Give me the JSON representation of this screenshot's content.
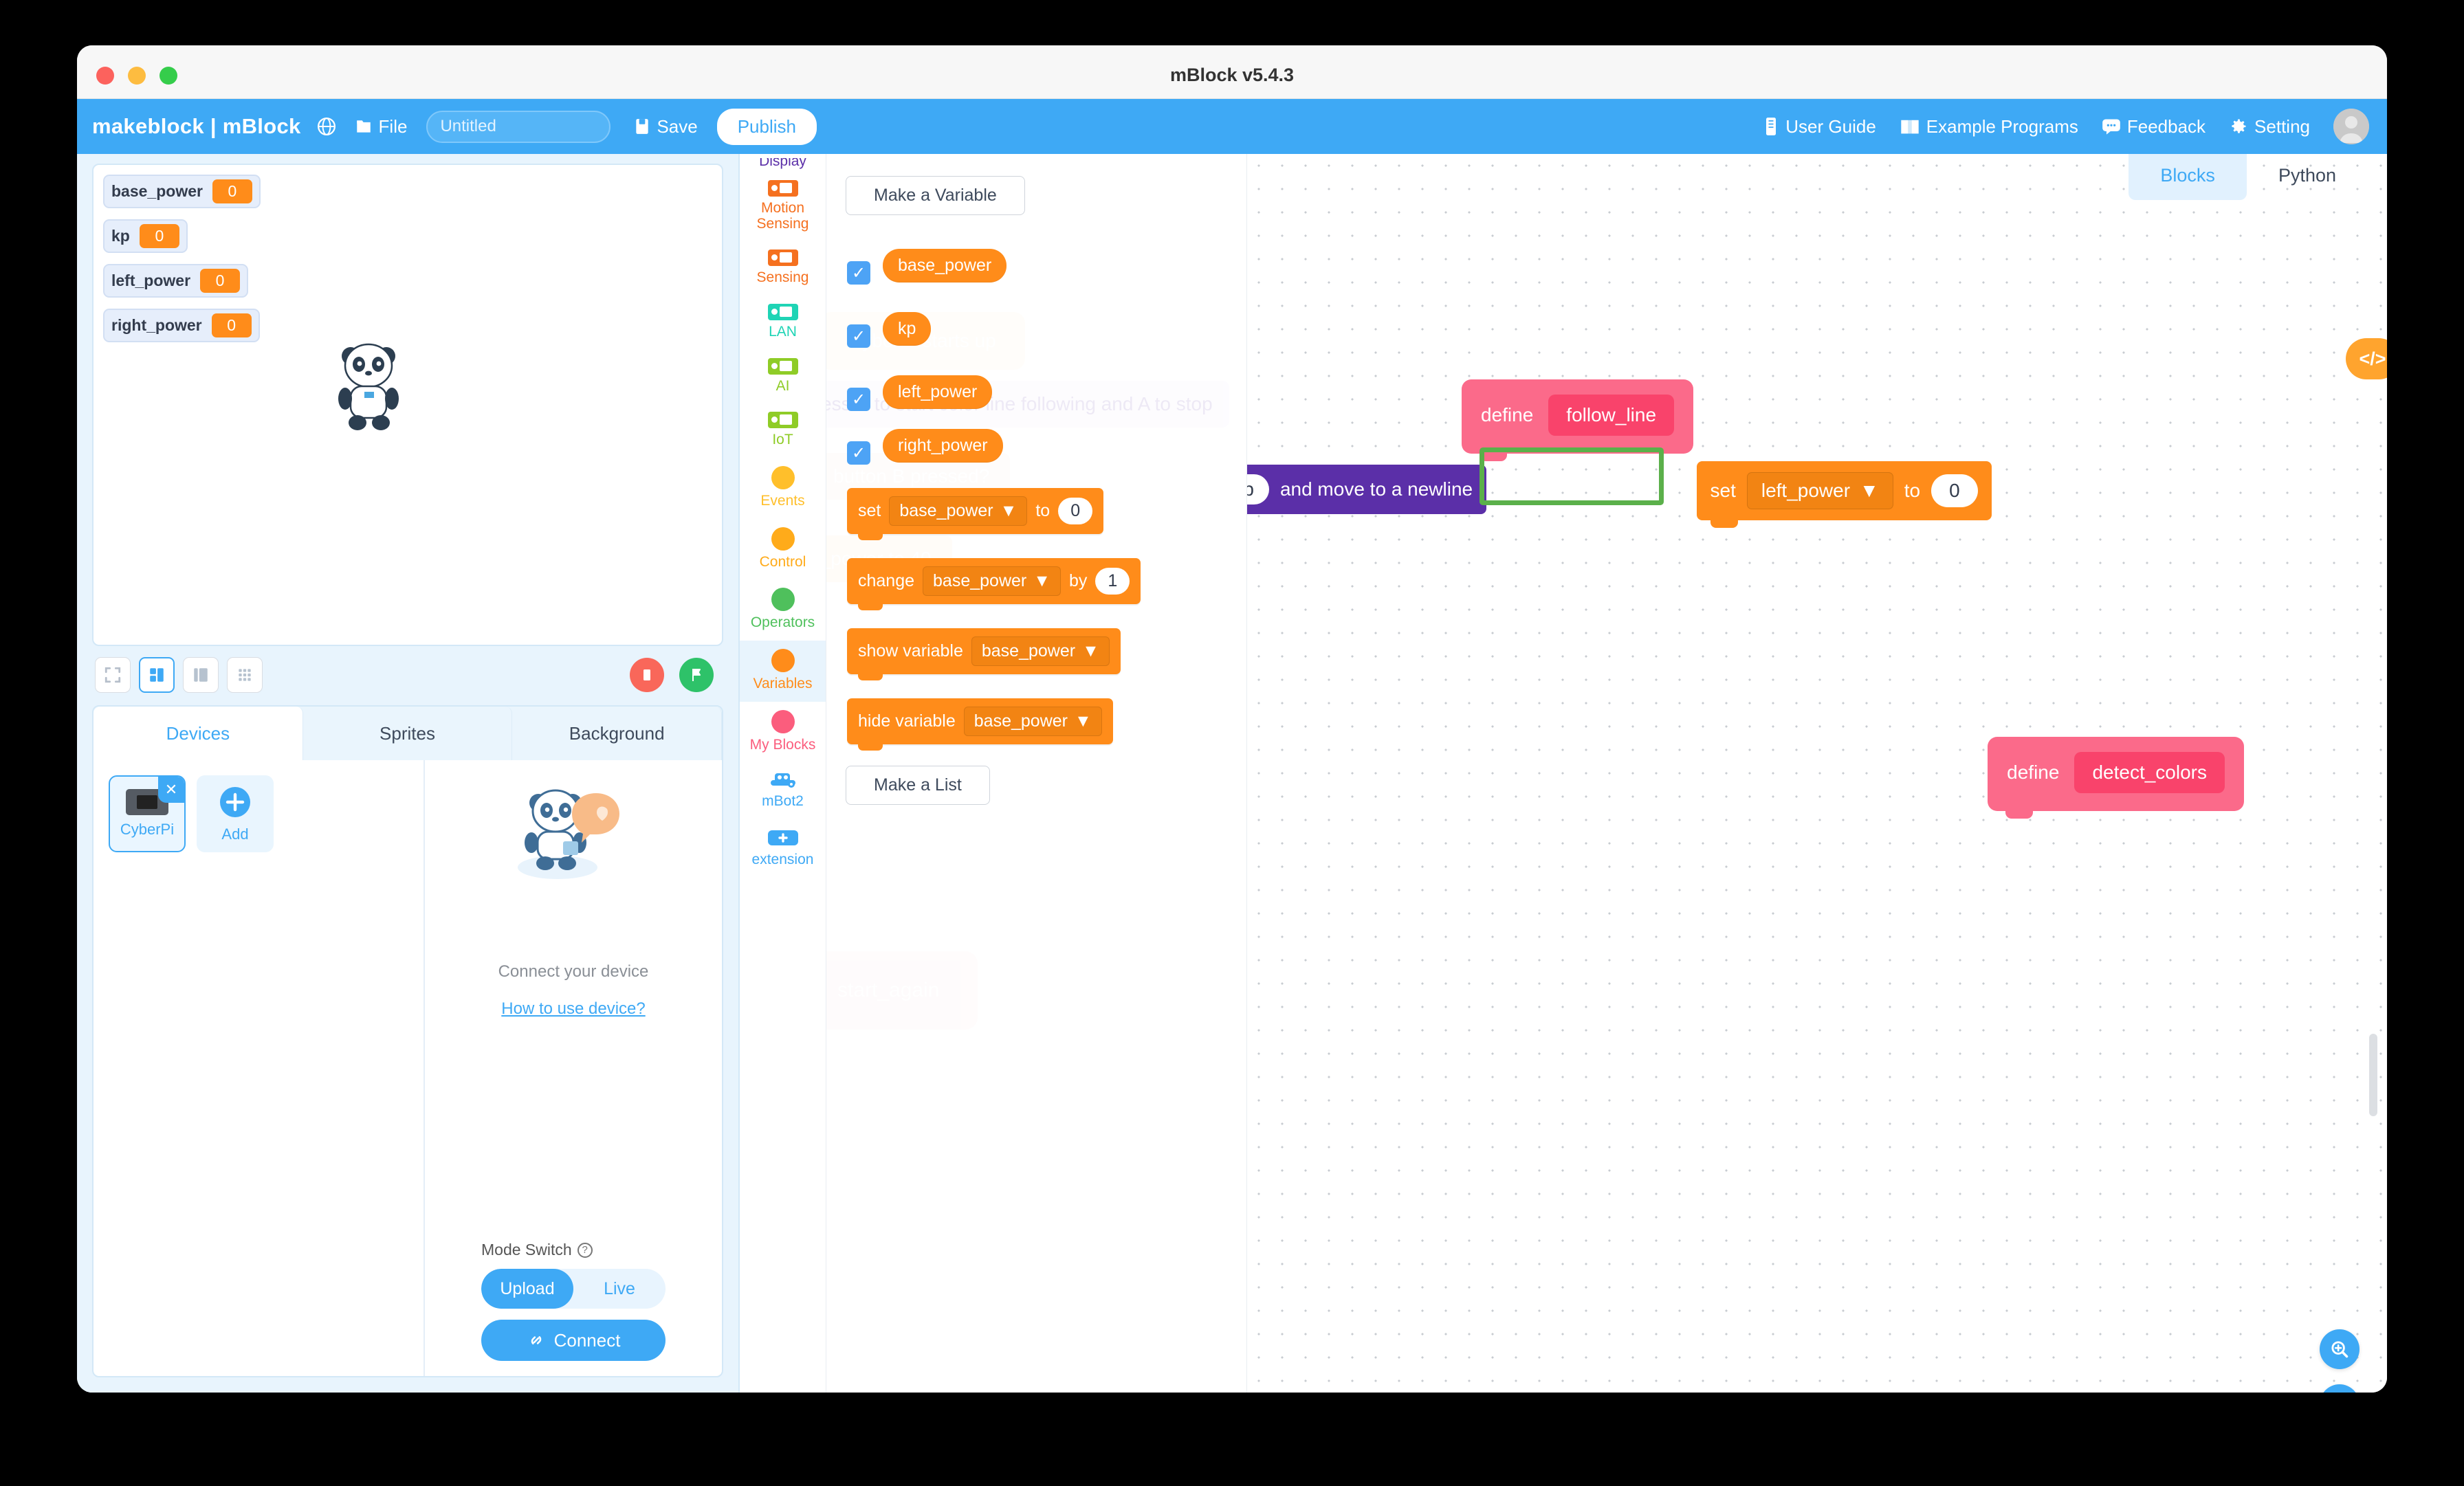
{
  "window": {
    "title": "mBlock v5.4.3"
  },
  "toolbar": {
    "brand": "makeblock | mBlock",
    "globe_icon": "globe-icon",
    "file_icon": "folder-icon",
    "file_label": "File",
    "project_name_value": "Untitled",
    "project_name_placeholder": "Untitled",
    "save_icon": "save-icon",
    "save_label": "Save",
    "publish_label": "Publish",
    "right_items": [
      {
        "label": "User Guide",
        "icon": "book-icon"
      },
      {
        "label": "Example Programs",
        "icon": "open-book-icon"
      },
      {
        "label": "Feedback",
        "icon": "chat-icon"
      },
      {
        "label": "Setting",
        "icon": "gear-icon"
      }
    ],
    "avatar_icon": "avatar-icon"
  },
  "stage": {
    "monitors": [
      {
        "name": "base_power",
        "value": "0"
      },
      {
        "name": "kp",
        "value": "0"
      },
      {
        "name": "left_power",
        "value": "0"
      },
      {
        "name": "right_power",
        "value": "0"
      }
    ],
    "sprite_icon": "panda-sprite",
    "controls": [
      {
        "name": "fullscreen-button",
        "icon": "fullscreen-icon"
      },
      {
        "name": "small-stage-button",
        "icon": "split-layout-icon"
      },
      {
        "name": "large-stage-button",
        "icon": "wide-layout-icon"
      },
      {
        "name": "grid-stage-button",
        "icon": "grid-icon"
      }
    ],
    "stop_icon": "stop-icon",
    "go_icon": "green-flag-icon"
  },
  "device_panel": {
    "tabs": [
      {
        "label": "Devices",
        "active": true
      },
      {
        "label": "Sprites",
        "active": false
      },
      {
        "label": "Background",
        "active": false
      }
    ],
    "devices": [
      {
        "label": "CyberPi",
        "selected": true,
        "close_icon": "close-icon"
      },
      {
        "label": "Add",
        "selected": false,
        "icon": "plus-icon"
      }
    ],
    "connect_text": "Connect your device",
    "howto_link": "How to use device?",
    "mode_label": "Mode Switch",
    "mode_help_icon": "question-icon",
    "mode_options": [
      {
        "label": "Upload",
        "active": true
      },
      {
        "label": "Live",
        "active": false
      }
    ],
    "connect_button": "Connect",
    "connect_icon": "link-icon"
  },
  "categories": [
    {
      "label": "Display",
      "color": "#5b2fa8",
      "shape": "board",
      "selected": false,
      "partial": true
    },
    {
      "label": "Motion Sensing",
      "color": "#f5701f",
      "shape": "board",
      "selected": false
    },
    {
      "label": "Sensing",
      "color": "#f5701f",
      "shape": "board",
      "selected": false
    },
    {
      "label": "LAN",
      "color": "#1fd4b5",
      "shape": "board",
      "selected": false
    },
    {
      "label": "AI",
      "color": "#8fcc27",
      "shape": "board",
      "selected": false
    },
    {
      "label": "IoT",
      "color": "#8fcc27",
      "shape": "board",
      "selected": false
    },
    {
      "label": "Events",
      "color": "#ffbf2b",
      "shape": "dot",
      "selected": false
    },
    {
      "label": "Control",
      "color": "#ffab1a",
      "shape": "dot",
      "selected": false
    },
    {
      "label": "Operators",
      "color": "#4fc05c",
      "shape": "dot",
      "selected": false
    },
    {
      "label": "Variables",
      "color": "#ff8c1a",
      "shape": "dot",
      "selected": true
    },
    {
      "label": "My Blocks",
      "color": "#fb5d7d",
      "shape": "dot",
      "selected": false
    },
    {
      "label": "mBot2",
      "color": "#3ea9f5",
      "shape": "robot",
      "selected": false
    },
    {
      "label": "extension",
      "color": "#3ea9f5",
      "shape": "plus",
      "selected": false
    }
  ],
  "palette": {
    "make_variable_label": "Make a Variable",
    "make_list_label": "Make a List",
    "variables": [
      {
        "name": "base_power",
        "checked": true
      },
      {
        "name": "kp",
        "checked": true
      },
      {
        "name": "left_power",
        "checked": true
      },
      {
        "name": "right_power",
        "checked": true
      }
    ],
    "blocks": [
      {
        "op": "set",
        "var": "base_power",
        "mid": "to",
        "value": "0"
      },
      {
        "op": "change",
        "var": "base_power",
        "mid": "by",
        "value": "1"
      },
      {
        "op": "show variable",
        "var": "base_power",
        "mid": "",
        "value": ""
      },
      {
        "op": "hide variable",
        "var": "base_power",
        "mid": "",
        "value": ""
      }
    ],
    "ghost_blocks": [
      "CyberPi starts up",
      "Press B to start color line following and A to stop",
      "button   B   pressed?",
      "base_power   to   40",
      "start_again"
    ]
  },
  "workspace": {
    "tabs": [
      {
        "label": "Blocks",
        "active": true
      },
      {
        "label": "Python",
        "active": false
      }
    ],
    "code_toggle_icon": "code-icon",
    "blocks": {
      "define_follow_line": {
        "keyword": "define",
        "name": "follow_line"
      },
      "set_left_power": {
        "op": "set",
        "var": "left_power",
        "mid": "to",
        "value": "0"
      },
      "newline_block": {
        "value": "stop",
        "text": "and move to a newline"
      },
      "define_detect_colors": {
        "keyword": "define",
        "name": "detect_colors"
      }
    },
    "highlight": {
      "target": "left_power-dropdown",
      "color": "#5bb04a"
    },
    "float_buttons": [
      {
        "name": "zoom-in-button",
        "icon": "zoom-in-icon"
      },
      {
        "name": "zoom-out-button",
        "icon": "zoom-out-icon"
      },
      {
        "name": "undo-button",
        "icon": "undo-icon"
      },
      {
        "name": "redo-button",
        "icon": "redo-icon"
      },
      {
        "name": "zoom-reset-button",
        "icon": "equals-icon"
      }
    ]
  }
}
